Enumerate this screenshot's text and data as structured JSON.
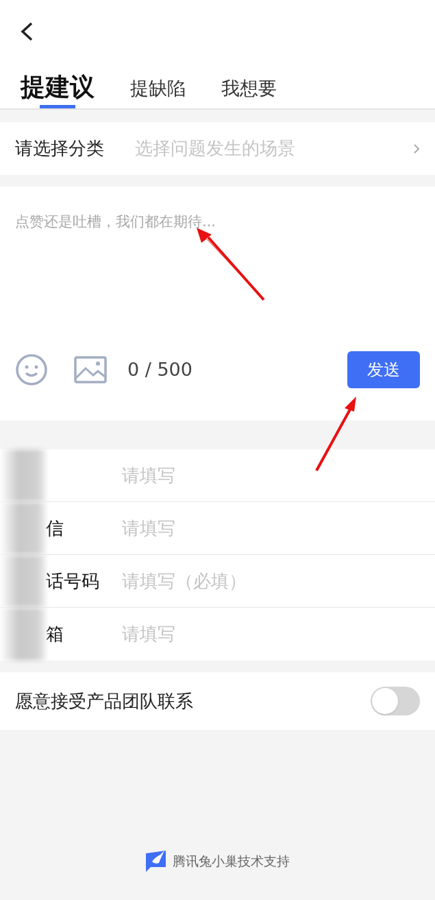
{
  "tabs": [
    {
      "label": "提建议",
      "selected": true
    },
    {
      "label": "提缺陷",
      "selected": false
    },
    {
      "label": "我想要",
      "selected": false
    }
  ],
  "category": {
    "label": "请选择分类",
    "placeholder": "选择问题发生的场景"
  },
  "feedback": {
    "placeholder": "点赞还是吐槽，我们都在期待...",
    "counter": "0 / 500",
    "send": "发送"
  },
  "contact_fields": [
    {
      "placeholder": "请填写"
    },
    {
      "label": "信",
      "placeholder": "请填写"
    },
    {
      "label": "话号码",
      "placeholder": "请填写（必填）"
    },
    {
      "label": "箱",
      "placeholder": "请填写"
    }
  ],
  "contact_consent": {
    "label": "愿意接受产品团队联系",
    "on": false
  },
  "footer": "腾讯兔小巢技术支持"
}
